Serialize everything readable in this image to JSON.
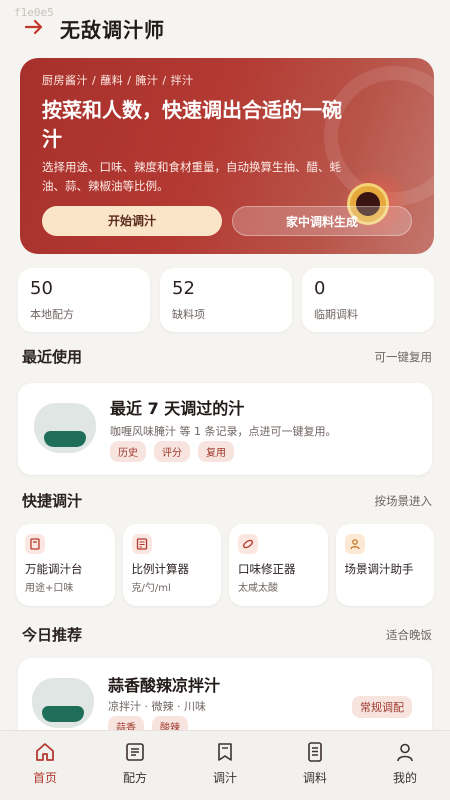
{
  "watermark": "f1e0e5",
  "header": {
    "title": "无敌调汁师"
  },
  "hero": {
    "categories": "厨房酱汁 / 蘸料 / 腌汁 / 拌汁",
    "title": "按菜和人数，快速调出合适的一碗汁",
    "description": "选择用途、口味、辣度和食材重量，自动换算生抽、醋、蚝油、蒜、辣椒油等比例。",
    "start_label": "开始调汁",
    "pantry_label": "家中调料生成"
  },
  "stats": [
    {
      "value": "50",
      "label": "本地配方"
    },
    {
      "value": "52",
      "label": "缺料项"
    },
    {
      "value": "0",
      "label": "临期调料"
    }
  ],
  "recent": {
    "section_title": "最近使用",
    "section_action": "可一键复用",
    "card_title": "最近 7 天调过的汁",
    "card_subtitle": "咖喱风味腌汁 等 1 条记录，点进可一键复用。",
    "tags": [
      "历史",
      "评分",
      "复用"
    ]
  },
  "quick": {
    "section_title": "快捷调汁",
    "section_action": "按场景进入",
    "tools": [
      {
        "name": "万能调汁台",
        "desc": "用途+口味",
        "icon": "bookmark-icon"
      },
      {
        "name": "比例计算器",
        "desc": "克/勺/ml",
        "icon": "calculator-icon"
      },
      {
        "name": "口味修正器",
        "desc": "太咸太酸",
        "icon": "leaf-icon"
      },
      {
        "name": "场景调汁助手",
        "desc": "",
        "icon": "user-icon"
      }
    ]
  },
  "today": {
    "section_title": "今日推荐",
    "section_action": "适合晚饭",
    "card_title": "蒜香酸辣凉拌汁",
    "card_subtitle": "凉拌汁 · 微辣 · 川味",
    "tags": [
      "蒜香",
      "酸辣"
    ],
    "badge": "常规调配"
  },
  "tabbar": {
    "active": "首页",
    "items": [
      {
        "label": "首页",
        "icon": "home-icon"
      },
      {
        "label": "配方",
        "icon": "recipe-icon"
      },
      {
        "label": "调汁",
        "icon": "bookmark-icon"
      },
      {
        "label": "调料",
        "icon": "list-icon"
      },
      {
        "label": "我的",
        "icon": "user-icon"
      }
    ]
  },
  "colors": {
    "accent": "#b3392f",
    "hero": "#a8302b",
    "background": "#f6f4f1"
  }
}
